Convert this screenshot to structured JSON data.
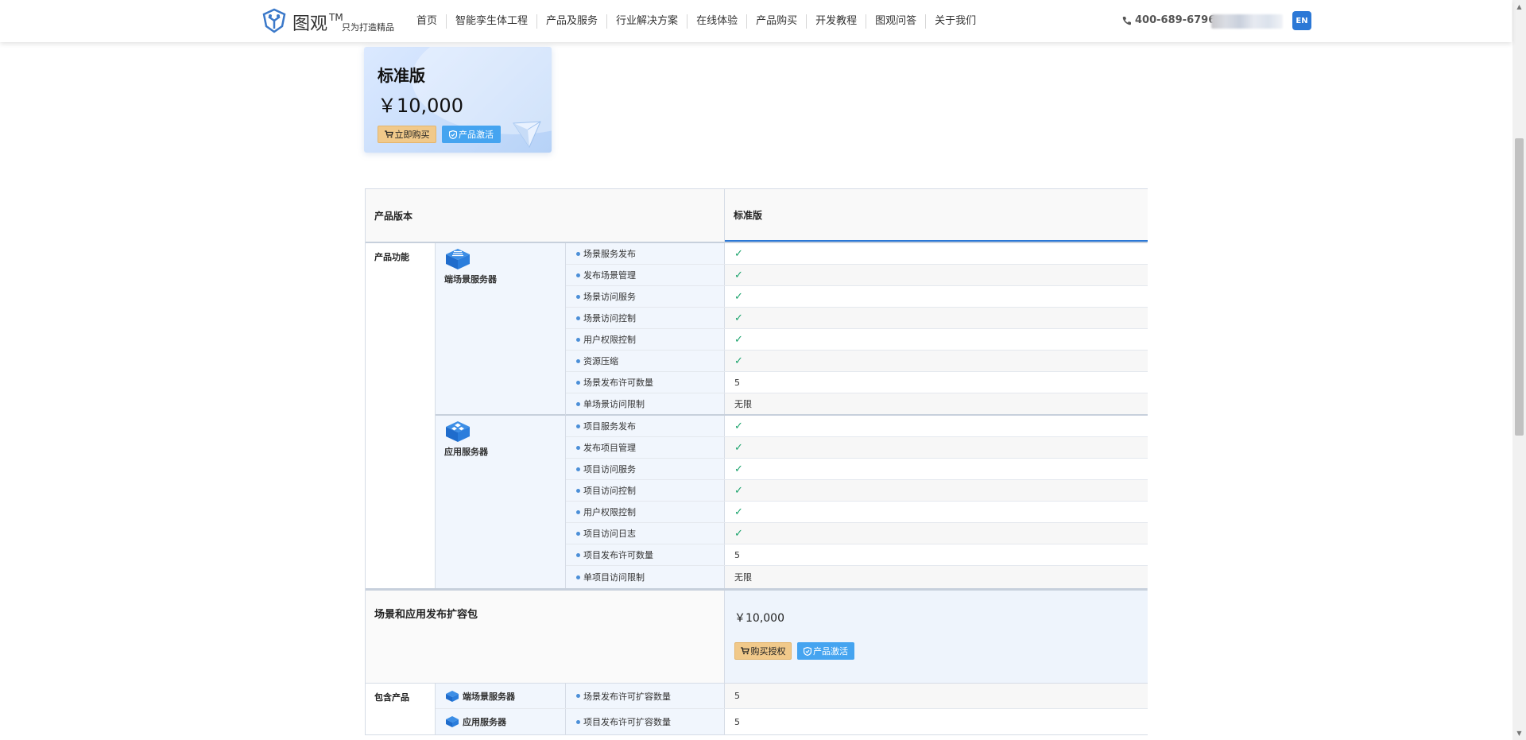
{
  "header": {
    "logo_name": "图观",
    "logo_tm": "TM",
    "logo_slogan": "只为打造精品",
    "nav": [
      "首页",
      "智能孪生体工程",
      "产品及服务",
      "行业解决方案",
      "在线体验",
      "产品购买",
      "开发教程",
      "图观问答",
      "关于我们"
    ],
    "phone": "400-689-6796",
    "lang_button": "EN",
    "colors": {
      "accent": "#2b78d6"
    }
  },
  "card": {
    "title": "标准版",
    "price": "￥10,000",
    "buy_label": "立即购买",
    "activate_label": "产品激活"
  },
  "table": {
    "header_left": "产品版本",
    "header_right": "标准版",
    "features_label": "产品功能",
    "groups": [
      {
        "name": "端场景服务器",
        "icon": "scene-server-icon",
        "rows": [
          {
            "feature": "场景服务发布",
            "value": "✓"
          },
          {
            "feature": "发布场景管理",
            "value": "✓"
          },
          {
            "feature": "场景访问服务",
            "value": "✓"
          },
          {
            "feature": "场景访问控制",
            "value": "✓"
          },
          {
            "feature": "用户权限控制",
            "value": "✓"
          },
          {
            "feature": "资源压缩",
            "value": "✓"
          },
          {
            "feature": "场景发布许可数量",
            "value": "5"
          },
          {
            "feature": "单场景访问限制",
            "value": "无限"
          }
        ]
      },
      {
        "name": "应用服务器",
        "icon": "app-server-icon",
        "rows": [
          {
            "feature": "项目服务发布",
            "value": "✓"
          },
          {
            "feature": "发布项目管理",
            "value": "✓"
          },
          {
            "feature": "项目访问服务",
            "value": "✓"
          },
          {
            "feature": "项目访问控制",
            "value": "✓"
          },
          {
            "feature": "用户权限控制",
            "value": "✓"
          },
          {
            "feature": "项目访问日志",
            "value": "✓"
          },
          {
            "feature": "项目发布许可数量",
            "value": "5"
          },
          {
            "feature": "单项目访问限制",
            "value": "无限"
          }
        ]
      }
    ],
    "expansion": {
      "title": "场景和应用发布扩容包",
      "price": "￥10,000",
      "buy_label": "购买授权",
      "activate_label": "产品激活"
    },
    "included_label": "包含产品",
    "included": [
      {
        "name": "端场景服务器",
        "feature": "场景发布许可扩容数量",
        "value": "5"
      },
      {
        "name": "应用服务器",
        "feature": "项目发布许可扩容数量",
        "value": "5"
      }
    ]
  }
}
